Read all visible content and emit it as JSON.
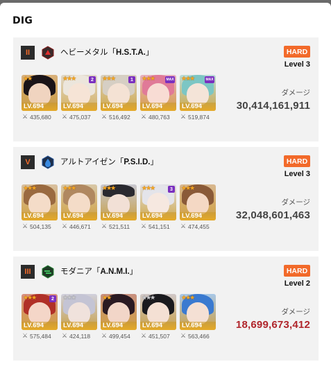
{
  "title": "DIG",
  "cards": [
    {
      "rank": "II",
      "boss_name": "ヘビーメタル「",
      "boss_code": "H.S.T.A.",
      "boss_close": "」",
      "difficulty": "HARD",
      "level": "Level 3",
      "damage_label": "ダメージ",
      "damage": "30,414,161,911",
      "damage_color": "#444444",
      "units": [
        {
          "level": "LV.694",
          "power": "435,680",
          "stars": "★★",
          "bond": ""
        },
        {
          "level": "LV.694",
          "power": "475,037",
          "stars": "★★★",
          "bond": "2"
        },
        {
          "level": "LV.694",
          "power": "516,492",
          "stars": "★★★",
          "bond": "1"
        },
        {
          "level": "LV.694",
          "power": "480,763",
          "stars": "★★★",
          "bond": "MAX"
        },
        {
          "level": "LV.694",
          "power": "519,874",
          "stars": "★★★",
          "bond": "MAX"
        }
      ]
    },
    {
      "rank": "V",
      "boss_name": "アルトアイゼン「",
      "boss_code": "P.S.I.D.",
      "boss_close": "」",
      "difficulty": "HARD",
      "level": "Level 3",
      "damage_label": "ダメージ",
      "damage": "32,048,601,463",
      "damage_color": "#444444",
      "units": [
        {
          "level": "LV.694",
          "power": "504,135",
          "stars": "★★★",
          "bond": ""
        },
        {
          "level": "LV.694",
          "power": "446,671",
          "stars": "★★★",
          "bond": ""
        },
        {
          "level": "LV.694",
          "power": "521,511",
          "stars": "★★★",
          "bond": ""
        },
        {
          "level": "LV.694",
          "power": "541,151",
          "stars": "★★★",
          "bond": "3"
        },
        {
          "level": "LV.694",
          "power": "474,455",
          "stars": "★★★",
          "bond": ""
        }
      ]
    },
    {
      "rank": "III",
      "boss_name": "モダニア「",
      "boss_code": "A.N.M.I.",
      "boss_close": "」",
      "difficulty": "HARD",
      "level": "Level 2",
      "damage_label": "ダメージ",
      "damage": "18,699,673,412",
      "damage_color": "#b0252b",
      "units": [
        {
          "level": "LV.694",
          "power": "575,484",
          "stars": "★★★",
          "bond": "2"
        },
        {
          "level": "LV.694",
          "power": "424,118",
          "stars": "★★★",
          "bond": ""
        },
        {
          "level": "LV.694",
          "power": "499,454",
          "stars": "★★",
          "bond": ""
        },
        {
          "level": "LV.694",
          "power": "451,507",
          "stars": "★★★",
          "bond": ""
        },
        {
          "level": "LV.694",
          "power": "563,466",
          "stars": "★★★",
          "bond": ""
        }
      ]
    }
  ],
  "colors": {
    "accent": "#f26a2a",
    "panel": "#f2f2f2",
    "rank_bg": "#2b2b2b"
  }
}
